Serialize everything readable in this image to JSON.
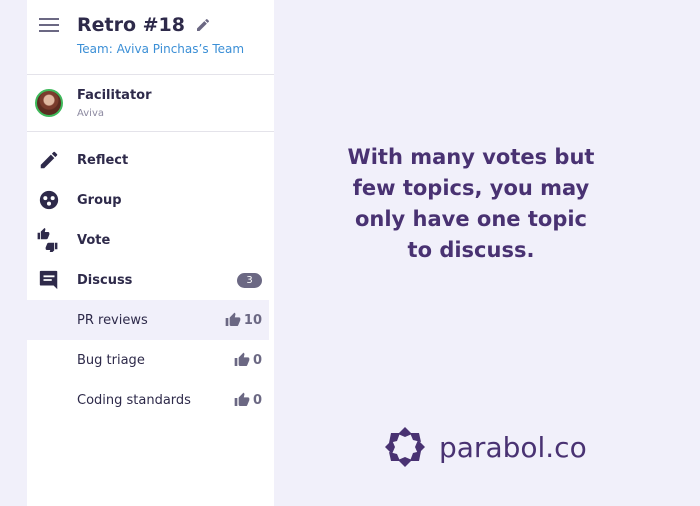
{
  "header": {
    "title": "Retro #18",
    "team": "Team: Aviva Pinchas’s Team"
  },
  "facilitator": {
    "label": "Facilitator",
    "name": "Aviva"
  },
  "nav": [
    {
      "label": "Reflect",
      "icon": "pencil-icon"
    },
    {
      "label": "Group",
      "icon": "group-icon"
    },
    {
      "label": "Vote",
      "icon": "vote-icon"
    },
    {
      "label": "Discuss",
      "icon": "discuss-icon",
      "badge": "3"
    }
  ],
  "topics": [
    {
      "label": "PR reviews",
      "votes": "10"
    },
    {
      "label": "Bug triage",
      "votes": "0"
    },
    {
      "label": "Coding standards",
      "votes": "0"
    }
  ],
  "main": {
    "message": "With many votes but few topics, you may only have one topic to discuss."
  },
  "logo": {
    "text": "parabol.co"
  },
  "colors": {
    "accent": "#493272",
    "link": "#3b8fd6",
    "avatar_ring": "#3fb95b"
  }
}
